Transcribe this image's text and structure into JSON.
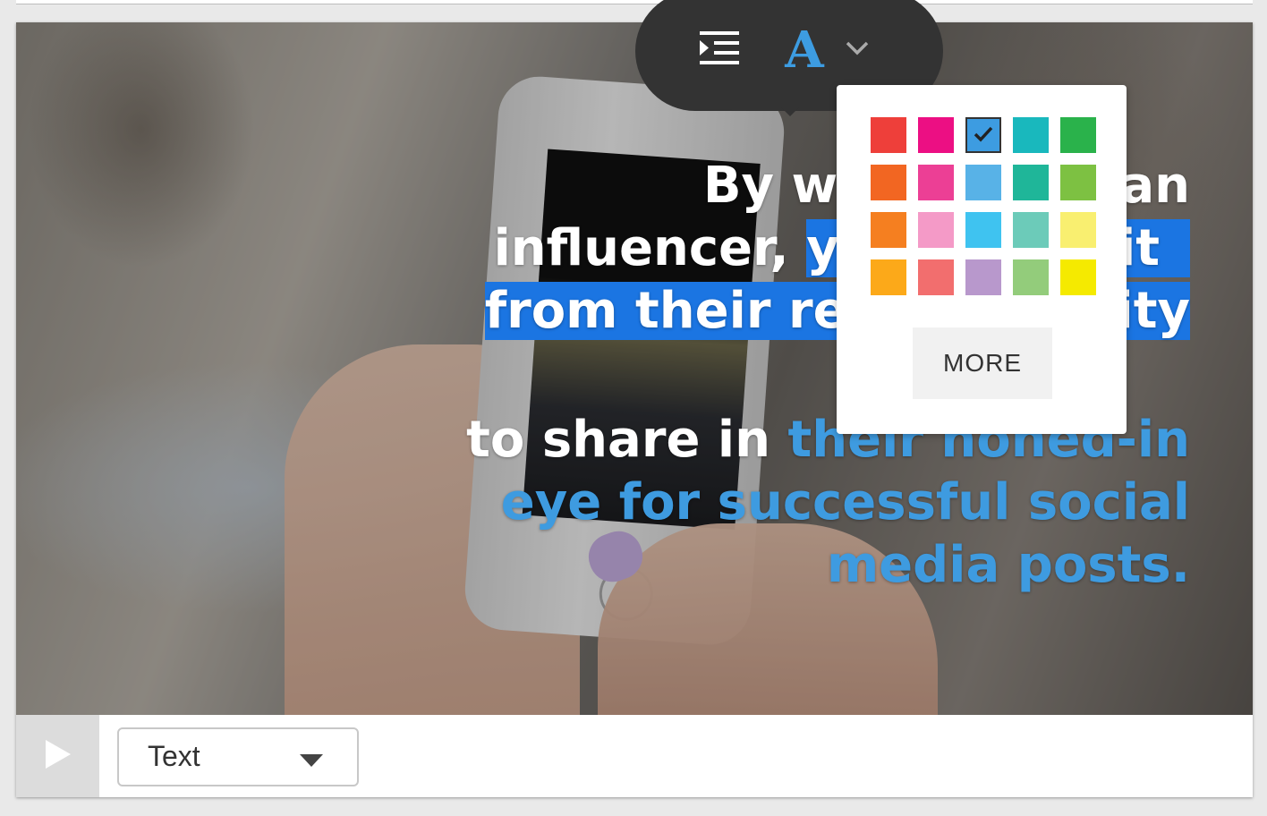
{
  "caption": {
    "line1": "By wor",
    "line1_end": "an",
    "line2_start": "influencer, ",
    "line2_sel": "y",
    "line2_sel_end": "fit",
    "line3_sel_start": "from their reac",
    "line3_sel_end": "ity",
    "line4_start": "to share in ",
    "line4_blue": "their honed-in",
    "line5_blue": "eye for successful social",
    "line6_blue": "media posts."
  },
  "toolbar": {
    "indent_icon": "indent-icon",
    "font_color_glyph": "A",
    "chevron_icon": "chevron-down-icon"
  },
  "color_picker": {
    "colors": [
      "#ee3f3a",
      "#ec0f83",
      "#3d9ce1",
      "#19b8bd",
      "#2ab24b",
      "#f26622",
      "#ec3f95",
      "#58b2e7",
      "#1fb699",
      "#7dc142",
      "#f57f20",
      "#f49ac7",
      "#3fc3f0",
      "#6ccbb9",
      "#f9ef70",
      "#fca919",
      "#f26e6e",
      "#b898cc",
      "#93cc7b",
      "#f5ea00"
    ],
    "selected_index": 2,
    "more_label": "MORE"
  },
  "bottom_bar": {
    "play_icon": "play-icon",
    "type_select_value": "Text"
  }
}
